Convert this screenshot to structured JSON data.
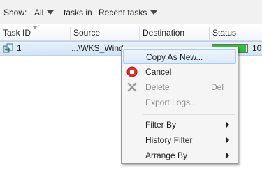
{
  "toolbar": {
    "show_label": "Show:",
    "filter_value": "All",
    "tasks_in_label": "tasks in",
    "range_value": "Recent tasks"
  },
  "grid": {
    "columns": [
      "Task ID",
      "Source",
      "Destination",
      "Status"
    ],
    "rows": [
      {
        "task_id": "1",
        "source": "...\\WKS_Wind",
        "destination": "",
        "status_text": "10",
        "progress": 0.95
      }
    ]
  },
  "context_menu": {
    "items": [
      {
        "label": "Copy As New...",
        "state": "highlighted"
      },
      {
        "label": "Cancel",
        "icon": "cancel-icon",
        "state": "enabled"
      },
      {
        "label": "Delete",
        "shortcut": "Del",
        "icon": "delete-icon",
        "state": "disabled"
      },
      {
        "label": "Export Logs...",
        "state": "disabled"
      },
      {
        "label": "Filter By",
        "submenu": true
      },
      {
        "label": "History Filter",
        "submenu": true
      },
      {
        "label": "Arrange By",
        "submenu": true
      }
    ]
  },
  "colors": {
    "progress_fill": "#2fc13a",
    "selection": "#d3e3f6",
    "cancel_icon": "#e0302b"
  }
}
